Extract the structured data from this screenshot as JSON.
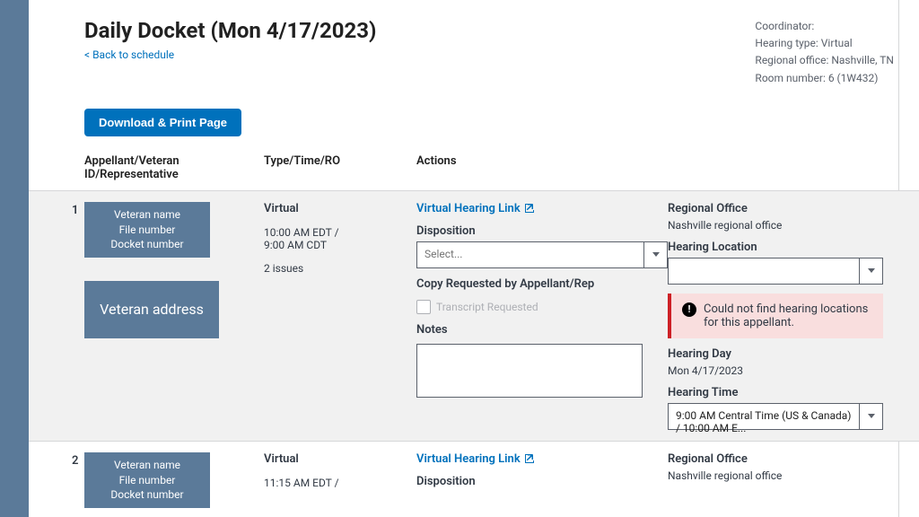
{
  "header": {
    "title": "Daily Docket (Mon 4/17/2023)",
    "back_link": "< Back to schedule",
    "download_btn": "Download & Print Page"
  },
  "meta": {
    "coordinator_label": "Coordinator:",
    "hearing_type": "Hearing type: Virtual",
    "regional_office": "Regional office: Nashville, TN",
    "room_number": "Room number: 6 (1W432)"
  },
  "columns": {
    "appellant": "Appellant/Veteran ID/Representative",
    "type": "Type/Time/RO",
    "actions": "Actions"
  },
  "labels": {
    "virtual_link": "Virtual Hearing Link",
    "disposition": "Disposition",
    "select_placeholder": "Select...",
    "copy_requested": "Copy Requested by Appellant/Rep",
    "transcript_requested": "Transcript Requested",
    "notes": "Notes",
    "regional_office": "Regional Office",
    "hearing_location": "Hearing Location",
    "hearing_day": "Hearing Day",
    "hearing_time": "Hearing Time",
    "error_text": "Could not find hearing locations for this appellant."
  },
  "rows": [
    {
      "num": "1",
      "veteran_box": "Veteran name\nFile number\nDocket number",
      "address_box": "Veteran address",
      "type": "Virtual",
      "time": "10:00 AM EDT /\n9:00 AM CDT",
      "issues": "2 issues",
      "ro_value": "Nashville regional office",
      "hearing_day_value": "Mon 4/17/2023",
      "hearing_time_value": "9:00 AM Central Time (US & Canada) / 10:00 AM E..."
    },
    {
      "num": "2",
      "veteran_box": "Veteran name\nFile number\nDocket number",
      "type": "Virtual",
      "time": "11:15 AM EDT /",
      "ro_value": "Nashville regional office"
    }
  ]
}
